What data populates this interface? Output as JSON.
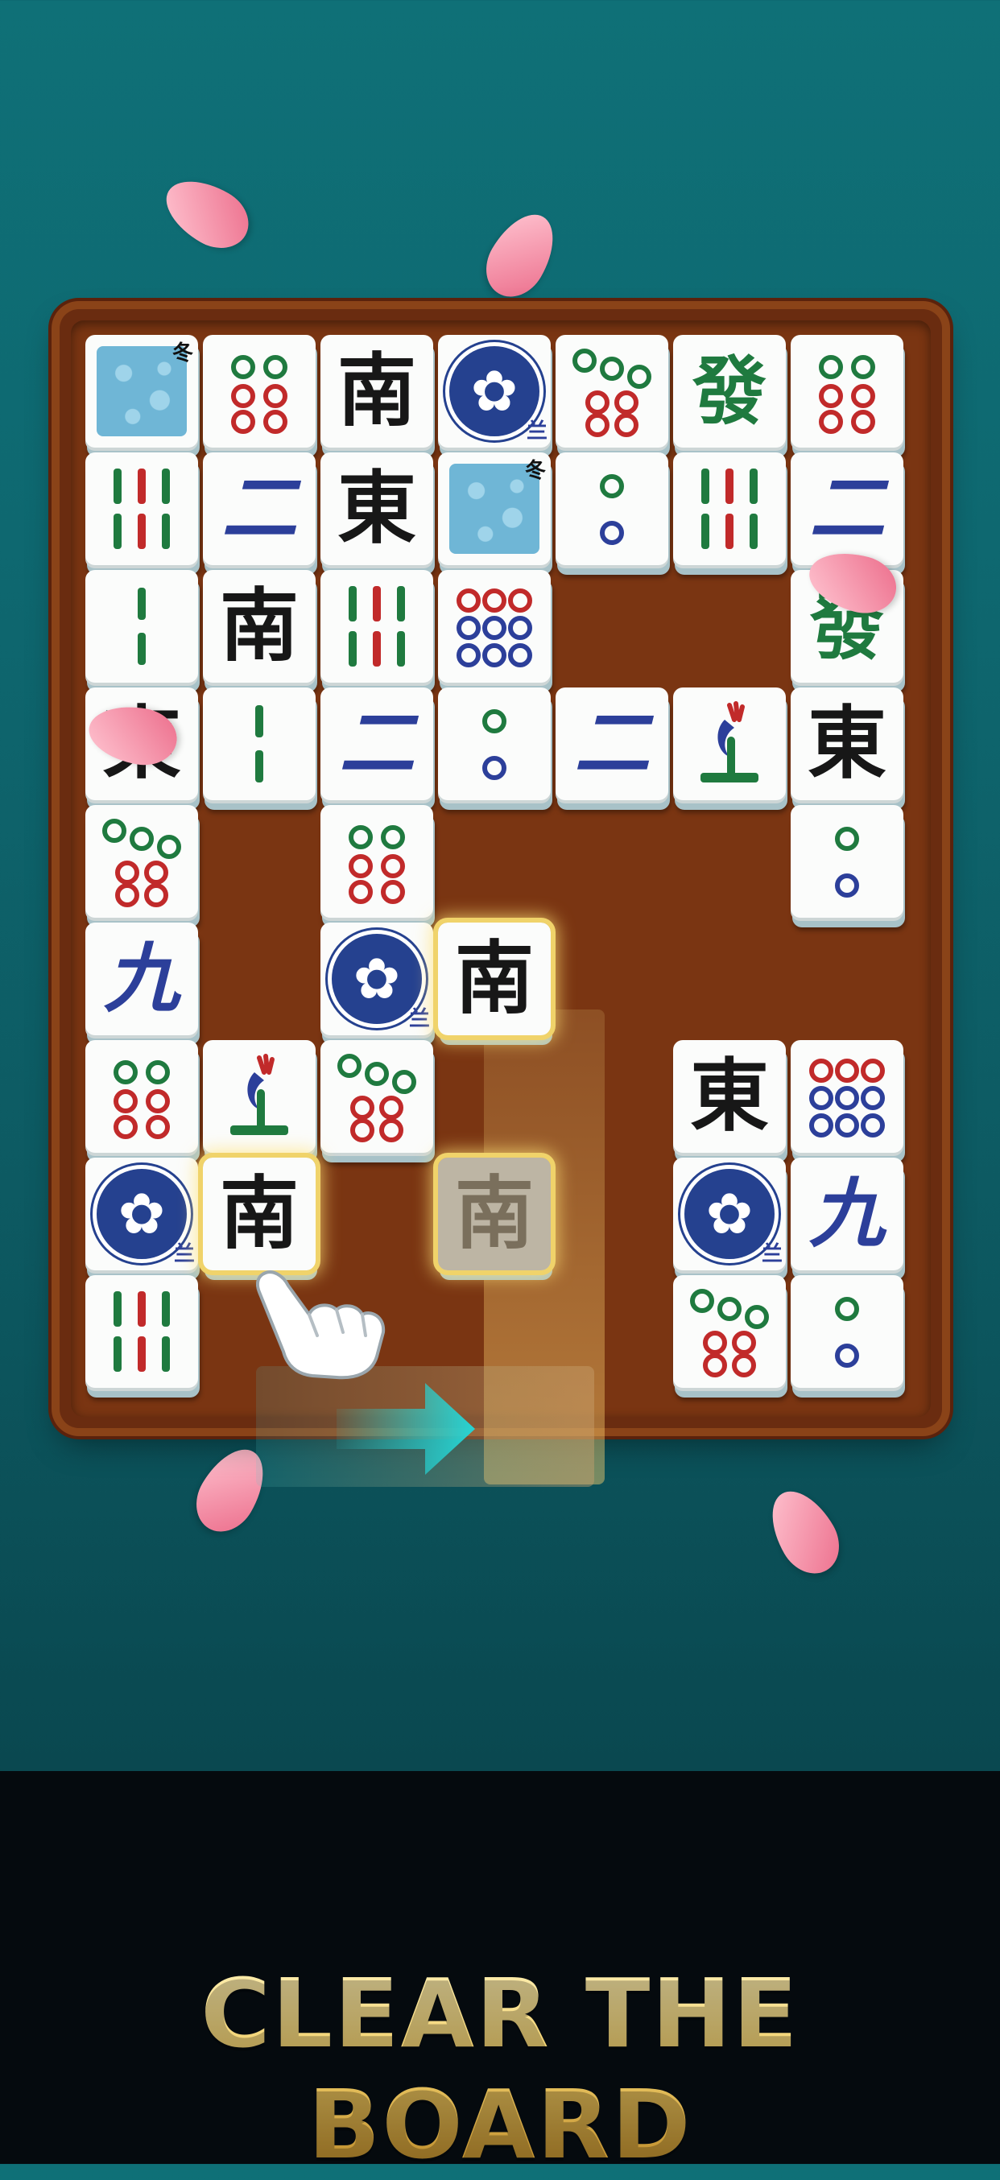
{
  "colors": {
    "background_top": "#0f7077",
    "background_bottom": "#093f46",
    "board_wood": "#7a3512",
    "tile_face": "#fbfcfb",
    "highlight_gold": "#f0d36a",
    "arrow_cyan": "#26d4d4",
    "headline_gold": "#e8c05a"
  },
  "headline": "CLEAR THE BOARD",
  "tiles": [
    {
      "col": 0,
      "row": 0,
      "kind": "winter",
      "text": "冬"
    },
    {
      "col": 1,
      "row": 0,
      "kind": "dots6"
    },
    {
      "col": 2,
      "row": 0,
      "kind": "char",
      "text": "南",
      "color": "black"
    },
    {
      "col": 3,
      "row": 0,
      "kind": "orchid",
      "text": "兰"
    },
    {
      "col": 4,
      "row": 0,
      "kind": "dots7"
    },
    {
      "col": 5,
      "row": 0,
      "kind": "char",
      "text": "發",
      "color": "green"
    },
    {
      "col": 6,
      "row": 0,
      "kind": "dots6"
    },
    {
      "col": 0,
      "row": 1,
      "kind": "bamboo6"
    },
    {
      "col": 1,
      "row": 1,
      "kind": "char",
      "text": "二",
      "color": "blue"
    },
    {
      "col": 2,
      "row": 1,
      "kind": "char",
      "text": "東",
      "color": "black"
    },
    {
      "col": 3,
      "row": 1,
      "kind": "winter",
      "text": "冬"
    },
    {
      "col": 4,
      "row": 1,
      "kind": "dots2"
    },
    {
      "col": 5,
      "row": 1,
      "kind": "bamboo6"
    },
    {
      "col": 6,
      "row": 1,
      "kind": "char",
      "text": "二",
      "color": "blue"
    },
    {
      "col": 0,
      "row": 2,
      "kind": "bamboo2"
    },
    {
      "col": 1,
      "row": 2,
      "kind": "char",
      "text": "南",
      "color": "black"
    },
    {
      "col": 2,
      "row": 2,
      "kind": "bamboo6"
    },
    {
      "col": 3,
      "row": 2,
      "kind": "dots9"
    },
    {
      "col": 6,
      "row": 2,
      "kind": "char",
      "text": "發",
      "color": "green"
    },
    {
      "col": 0,
      "row": 3,
      "kind": "char",
      "text": "東",
      "color": "black"
    },
    {
      "col": 1,
      "row": 3,
      "kind": "bamboo2"
    },
    {
      "col": 2,
      "row": 3,
      "kind": "char",
      "text": "二",
      "color": "blue"
    },
    {
      "col": 3,
      "row": 3,
      "kind": "dots2"
    },
    {
      "col": 4,
      "row": 3,
      "kind": "char",
      "text": "二",
      "color": "blue"
    },
    {
      "col": 5,
      "row": 3,
      "kind": "bird",
      "text": "1"
    },
    {
      "col": 6,
      "row": 3,
      "kind": "char",
      "text": "東",
      "color": "black"
    },
    {
      "col": 0,
      "row": 4,
      "kind": "dots7"
    },
    {
      "col": 2,
      "row": 4,
      "kind": "dots6"
    },
    {
      "col": 6,
      "row": 4,
      "kind": "dots2"
    },
    {
      "col": 0,
      "row": 5,
      "kind": "char",
      "text": "九",
      "color": "blue"
    },
    {
      "col": 2,
      "row": 5,
      "kind": "orchid",
      "text": "兰"
    },
    {
      "col": 3,
      "row": 5,
      "kind": "char",
      "text": "南",
      "color": "black",
      "state": "selected"
    },
    {
      "col": 0,
      "row": 6,
      "kind": "dots6"
    },
    {
      "col": 1,
      "row": 6,
      "kind": "bird",
      "text": "1"
    },
    {
      "col": 2,
      "row": 6,
      "kind": "dots7"
    },
    {
      "col": 5,
      "row": 6,
      "kind": "char",
      "text": "東",
      "color": "black"
    },
    {
      "col": 6,
      "row": 6,
      "kind": "dots9"
    },
    {
      "col": 0,
      "row": 7,
      "kind": "orchid",
      "text": "兰"
    },
    {
      "col": 1,
      "row": 7,
      "kind": "char",
      "text": "南",
      "color": "black",
      "state": "selected"
    },
    {
      "col": 3,
      "row": 7,
      "kind": "char",
      "text": "南",
      "color": "black",
      "state": "ghost"
    },
    {
      "col": 5,
      "row": 7,
      "kind": "orchid",
      "text": "兰"
    },
    {
      "col": 6,
      "row": 7,
      "kind": "char",
      "text": "九",
      "color": "blue"
    },
    {
      "col": 0,
      "row": 8,
      "kind": "bamboo6"
    },
    {
      "col": 5,
      "row": 8,
      "kind": "dots7"
    },
    {
      "col": 6,
      "row": 8,
      "kind": "dots2"
    }
  ]
}
